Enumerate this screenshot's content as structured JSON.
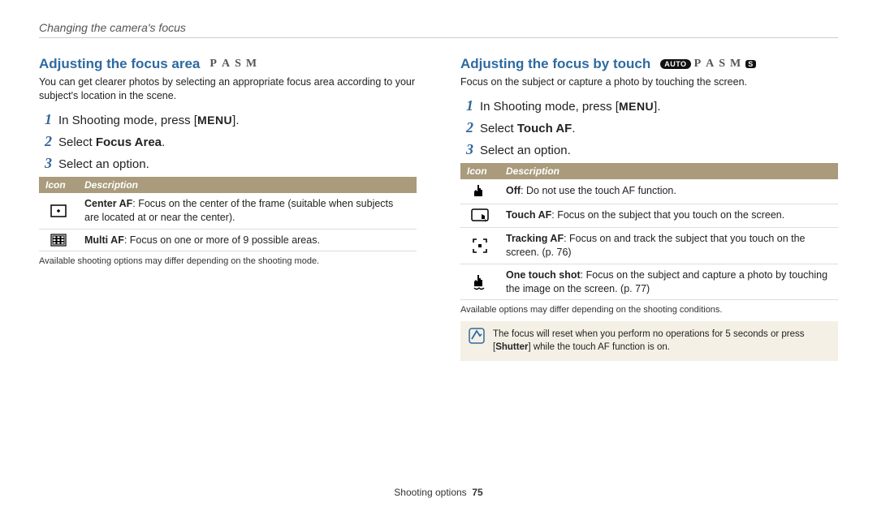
{
  "breadcrumb": "Changing the camera's focus",
  "left": {
    "heading": "Adjusting the focus area",
    "modes": [
      "P",
      "A",
      "S",
      "M"
    ],
    "intro": "You can get clearer photos by selecting an appropriate focus area according to your subject's location in the scene.",
    "steps": {
      "s1a": "In Shooting mode, press [",
      "s1b": "MENU",
      "s1c": "].",
      "s2a": "Select ",
      "s2b": "Focus Area",
      "s2c": ".",
      "s3": "Select an option."
    },
    "table": {
      "h1": "Icon",
      "h2": "Description",
      "r1b": "Center AF",
      "r1t": ": Focus on the center of the frame (suitable when subjects are located at or near the center).",
      "r2b": "Multi AF",
      "r2t": ": Focus on one or more of 9 possible areas."
    },
    "note": "Available shooting options may differ depending on the shooting mode."
  },
  "right": {
    "heading": "Adjusting the focus by touch",
    "modes_auto": "AUTO",
    "modes_letters": [
      "P",
      "A",
      "S",
      "M"
    ],
    "modes_s": "S",
    "intro": "Focus on the subject or capture a photo by touching the screen.",
    "steps": {
      "s1a": "In Shooting mode, press [",
      "s1b": "MENU",
      "s1c": "].",
      "s2a": "Select ",
      "s2b": "Touch AF",
      "s2c": ".",
      "s3": "Select an option."
    },
    "table": {
      "h1": "Icon",
      "h2": "Description",
      "r1b": "Off",
      "r1t": ": Do not use the touch AF function.",
      "r2b": "Touch AF",
      "r2t": ": Focus on the subject that you touch on the screen.",
      "r3b": "Tracking AF",
      "r3t": ": Focus on and track the subject that you touch on the screen. (p. 76)",
      "r4b": "One touch shot",
      "r4t": ": Focus on the subject and capture a photo by touching the image on the screen. (p. 77)"
    },
    "note": "Available options may differ depending on the shooting conditions.",
    "callout_a": "The focus will reset when you perform no operations for 5 seconds or press [",
    "callout_b": "Shutter",
    "callout_c": "] while the touch AF function is on."
  },
  "footer": {
    "section": "Shooting options",
    "page": "75"
  }
}
